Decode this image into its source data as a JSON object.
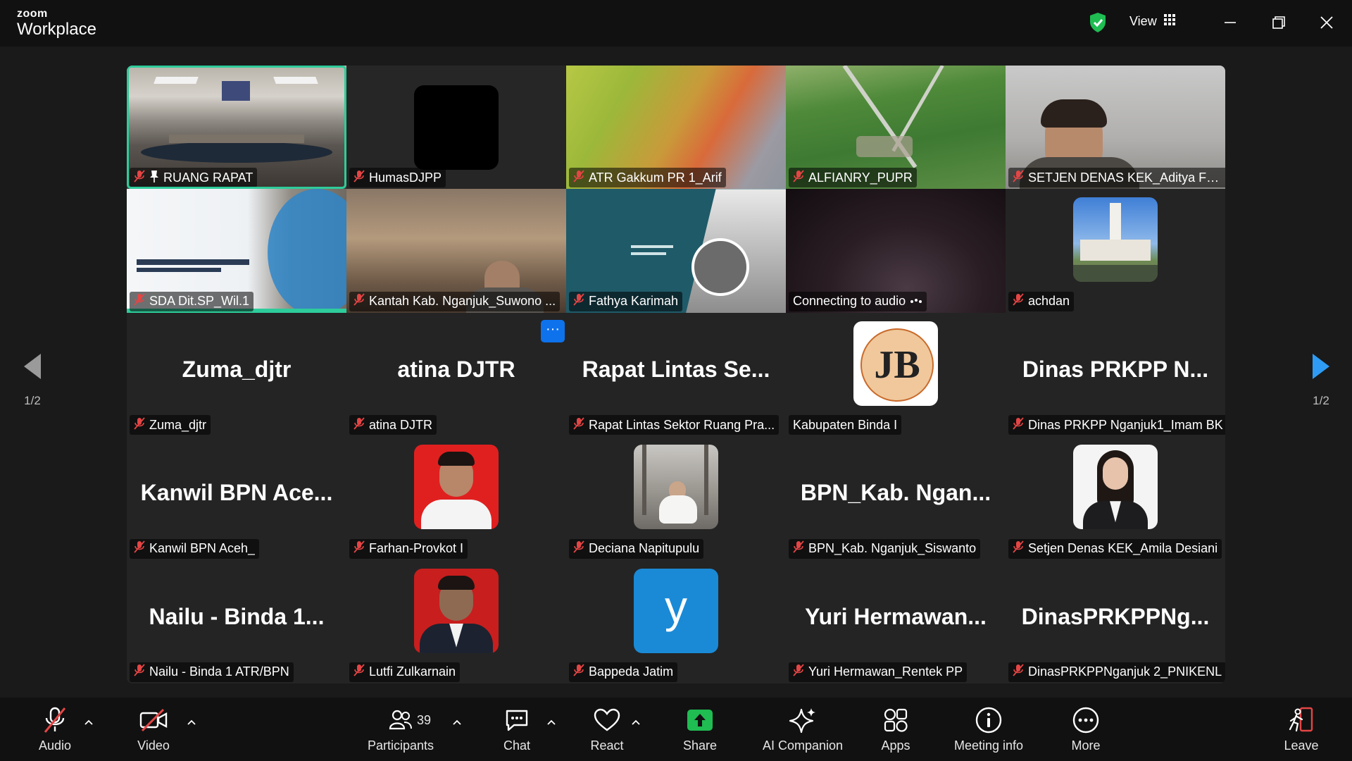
{
  "app": {
    "brand_small": "zoom",
    "brand_big": "Workplace"
  },
  "titlebar": {
    "view_label": "View"
  },
  "pager": {
    "left": "1/2",
    "right": "1/2"
  },
  "colors": {
    "active_border": "#2ecc9a",
    "accent": "#0e72ed",
    "share_green": "#1fbd52",
    "mute_red": "#e54545"
  },
  "tiles": [
    {
      "label": "RUANG RAPAT",
      "pinned": true
    },
    {
      "label": "HumasDJPP"
    },
    {
      "label": "ATR Gakkum PR 1_Arif"
    },
    {
      "label": "ALFIANRY_PUPR"
    },
    {
      "label": "SETJEN DENAS KEK_Aditya Fak..."
    },
    {
      "label": "SDA Dit.SP_Wil.1"
    },
    {
      "label": "Kantah Kab. Nganjuk_Suwono ..."
    },
    {
      "label": "Fathya Karimah"
    },
    {
      "label": "Connecting to audio"
    },
    {
      "label": "achdan"
    },
    {
      "big": "Zuma_djtr",
      "label": "Zuma_djtr"
    },
    {
      "big": "atina DJTR",
      "label": "atina DJTR"
    },
    {
      "big": "Rapat Lintas Se...",
      "label": "Rapat Lintas Sektor Ruang Pra..."
    },
    {
      "label": "Kabupaten Binda I",
      "avatar_text": "JB"
    },
    {
      "big": "Dinas PRKPP N...",
      "label": "Dinas PRKPP Nganjuk1_Imam BK"
    },
    {
      "big": "Kanwil BPN Ace...",
      "label": "Kanwil BPN Aceh_"
    },
    {
      "label": "Farhan-Provkot I"
    },
    {
      "label": "Deciana Napitupulu"
    },
    {
      "big": "BPN_Kab. Ngan...",
      "label": "BPN_Kab. Nganjuk_Siswanto"
    },
    {
      "label": "Setjen Denas KEK_Amila Desiani"
    },
    {
      "big": "Nailu - Binda 1...",
      "label": "Nailu - Binda 1 ATR/BPN"
    },
    {
      "label": "Lutfi Zulkarnain"
    },
    {
      "label": "Bappeda Jatim",
      "avatar_text": "y"
    },
    {
      "big": "Yuri Hermawan...",
      "label": "Yuri Hermawan_Rentek PP"
    },
    {
      "big": "DinasPRKPPNg...",
      "label": "DinasPRKPPNganjuk 2_PNIKENL"
    }
  ],
  "toolbar": {
    "audio": "Audio",
    "video": "Video",
    "participants": "Participants",
    "participants_count": "39",
    "chat": "Chat",
    "react": "React",
    "share": "Share",
    "ai": "AI Companion",
    "apps": "Apps",
    "meeting_info": "Meeting info",
    "more": "More",
    "leave": "Leave"
  }
}
